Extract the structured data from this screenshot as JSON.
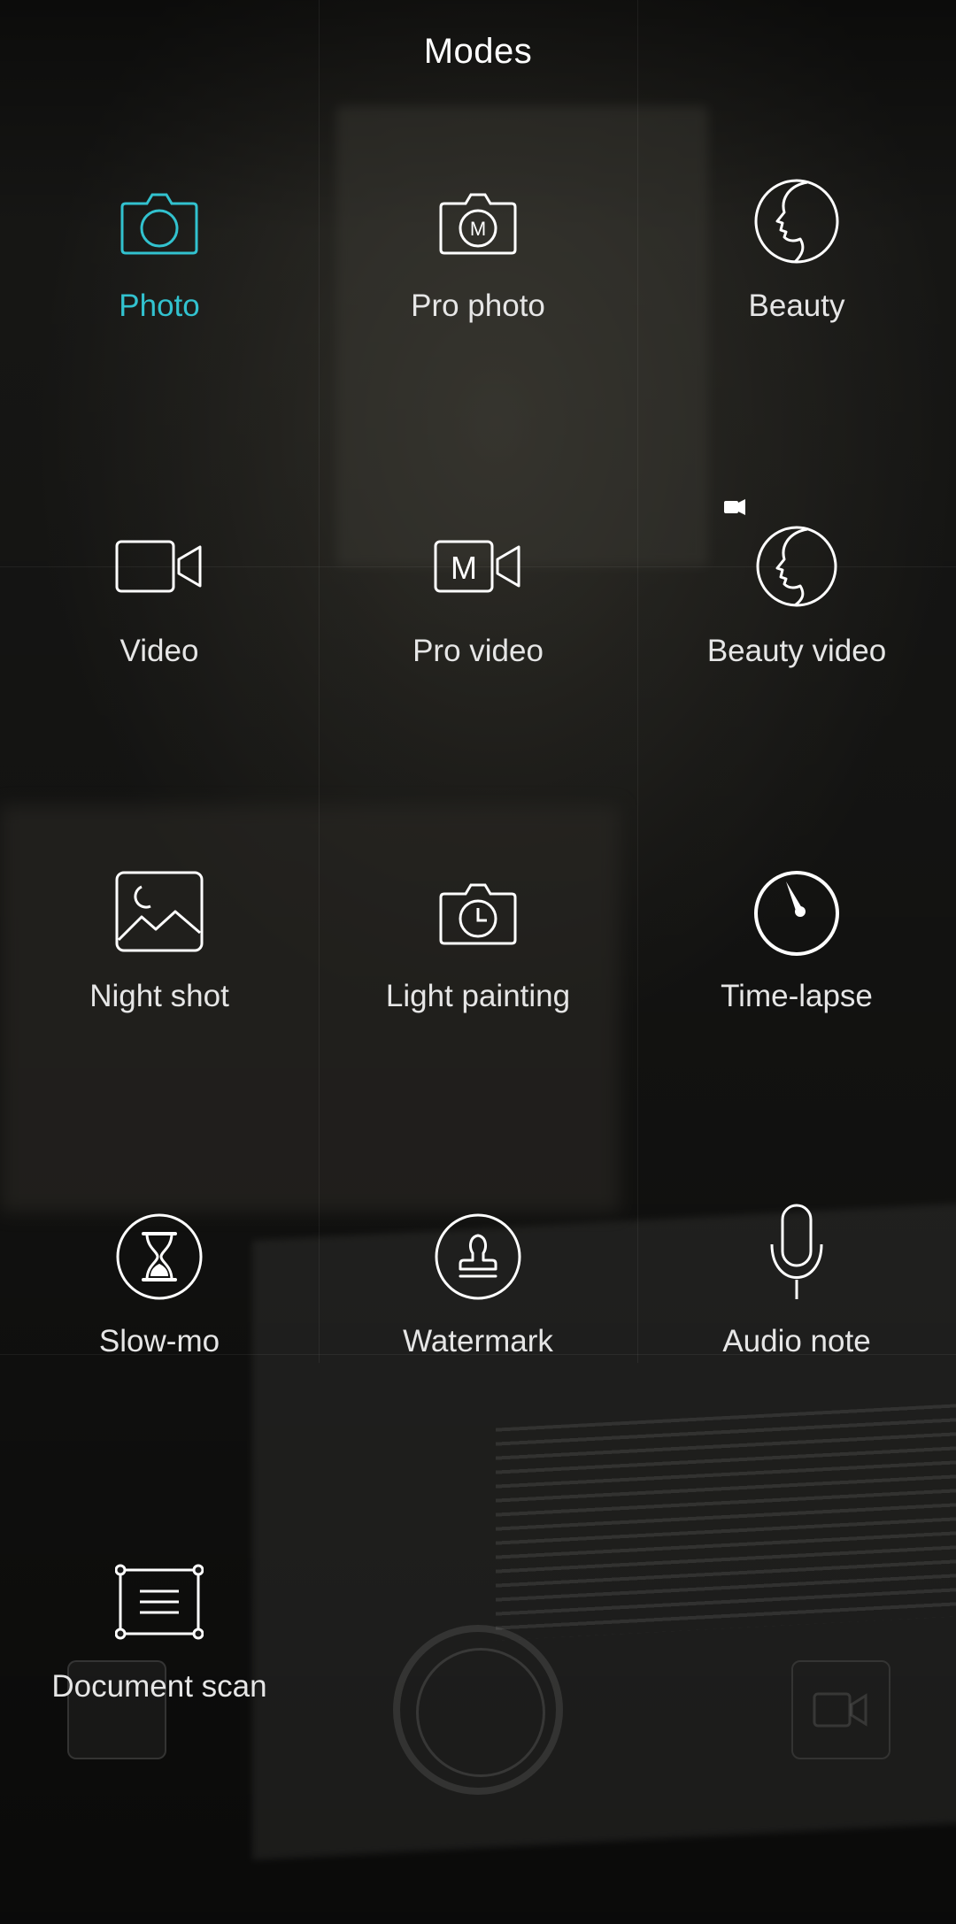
{
  "header": {
    "title": "Modes"
  },
  "colors": {
    "accent": "#32c2cf",
    "icon": "#ffffff",
    "label": "#e6e6e6"
  },
  "modes": [
    {
      "label": "Photo",
      "icon": "camera-icon",
      "selected": true
    },
    {
      "label": "Pro photo",
      "icon": "pro-photo-icon",
      "selected": false
    },
    {
      "label": "Beauty",
      "icon": "beauty-face-icon",
      "selected": false
    },
    {
      "label": "Video",
      "icon": "video-camera-icon",
      "selected": false
    },
    {
      "label": "Pro video",
      "icon": "pro-video-icon",
      "selected": false
    },
    {
      "label": "Beauty video",
      "icon": "beauty-video-icon",
      "selected": false
    },
    {
      "label": "Night shot",
      "icon": "night-shot-icon",
      "selected": false
    },
    {
      "label": "Light painting",
      "icon": "light-painting-icon",
      "selected": false
    },
    {
      "label": "Time-lapse",
      "icon": "time-lapse-icon",
      "selected": false
    },
    {
      "label": "Slow-mo",
      "icon": "hourglass-icon",
      "selected": false
    },
    {
      "label": "Watermark",
      "icon": "stamp-icon",
      "selected": false
    },
    {
      "label": "Audio note",
      "icon": "microphone-icon",
      "selected": false
    },
    {
      "label": "Document scan",
      "icon": "document-scan-icon",
      "selected": false
    }
  ]
}
